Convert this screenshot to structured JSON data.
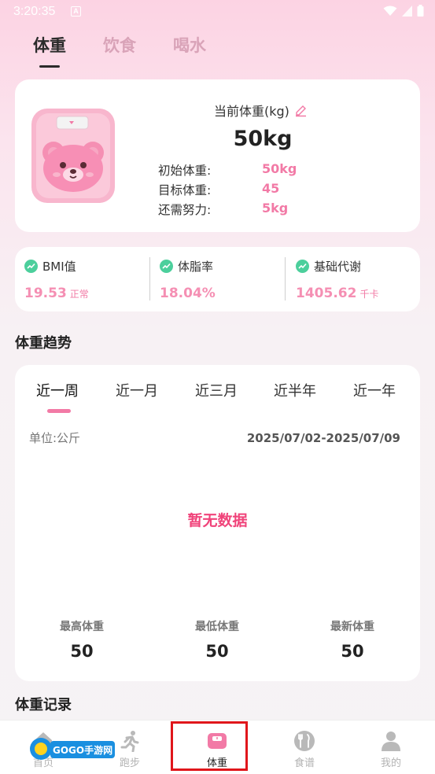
{
  "status_bar": {
    "time": "3:20:35",
    "notification_icon": "A"
  },
  "top_tabs": [
    {
      "label": "体重",
      "active": true
    },
    {
      "label": "饮食",
      "active": false
    },
    {
      "label": "喝水",
      "active": false
    }
  ],
  "weight_card": {
    "current_label": "当前体重(kg)",
    "current_value": "50kg",
    "rows": [
      {
        "label": "初始体重:",
        "value": "50kg"
      },
      {
        "label": "目标体重:",
        "value": "45"
      },
      {
        "label": "还需努力:",
        "value": "5kg"
      }
    ]
  },
  "stats": [
    {
      "label": "BMI值",
      "value": "19.53",
      "unit": "正常"
    },
    {
      "label": "体脂率",
      "value": "18.04%",
      "unit": ""
    },
    {
      "label": "基础代谢",
      "value": "1405.62",
      "unit": "千卡"
    }
  ],
  "trend": {
    "section_title": "体重趋势",
    "periods": [
      "近一周",
      "近一月",
      "近三月",
      "近半年",
      "近一年"
    ],
    "active_period": "近一周",
    "unit_label": "单位:公斤",
    "date_range": "2025/07/02-2025/07/09",
    "empty_text": "暂无数据",
    "summary": [
      {
        "label": "最高体重",
        "value": "50"
      },
      {
        "label": "最低体重",
        "value": "50"
      },
      {
        "label": "最新体重",
        "value": "50"
      }
    ]
  },
  "records_title": "体重记录",
  "bottom_nav": [
    {
      "label": "首页",
      "icon": "home-icon"
    },
    {
      "label": "跑步",
      "icon": "running-icon"
    },
    {
      "label": "体重",
      "icon": "scale-icon",
      "active": true
    },
    {
      "label": "食谱",
      "icon": "utensils-icon"
    },
    {
      "label": "我的",
      "icon": "user-icon"
    }
  ],
  "watermark_text": "GOGO手游网",
  "colors": {
    "accent": "#f27aa6",
    "alert": "#f0437a",
    "positive": "#4ccf9c",
    "highlight": "#e0161b"
  }
}
